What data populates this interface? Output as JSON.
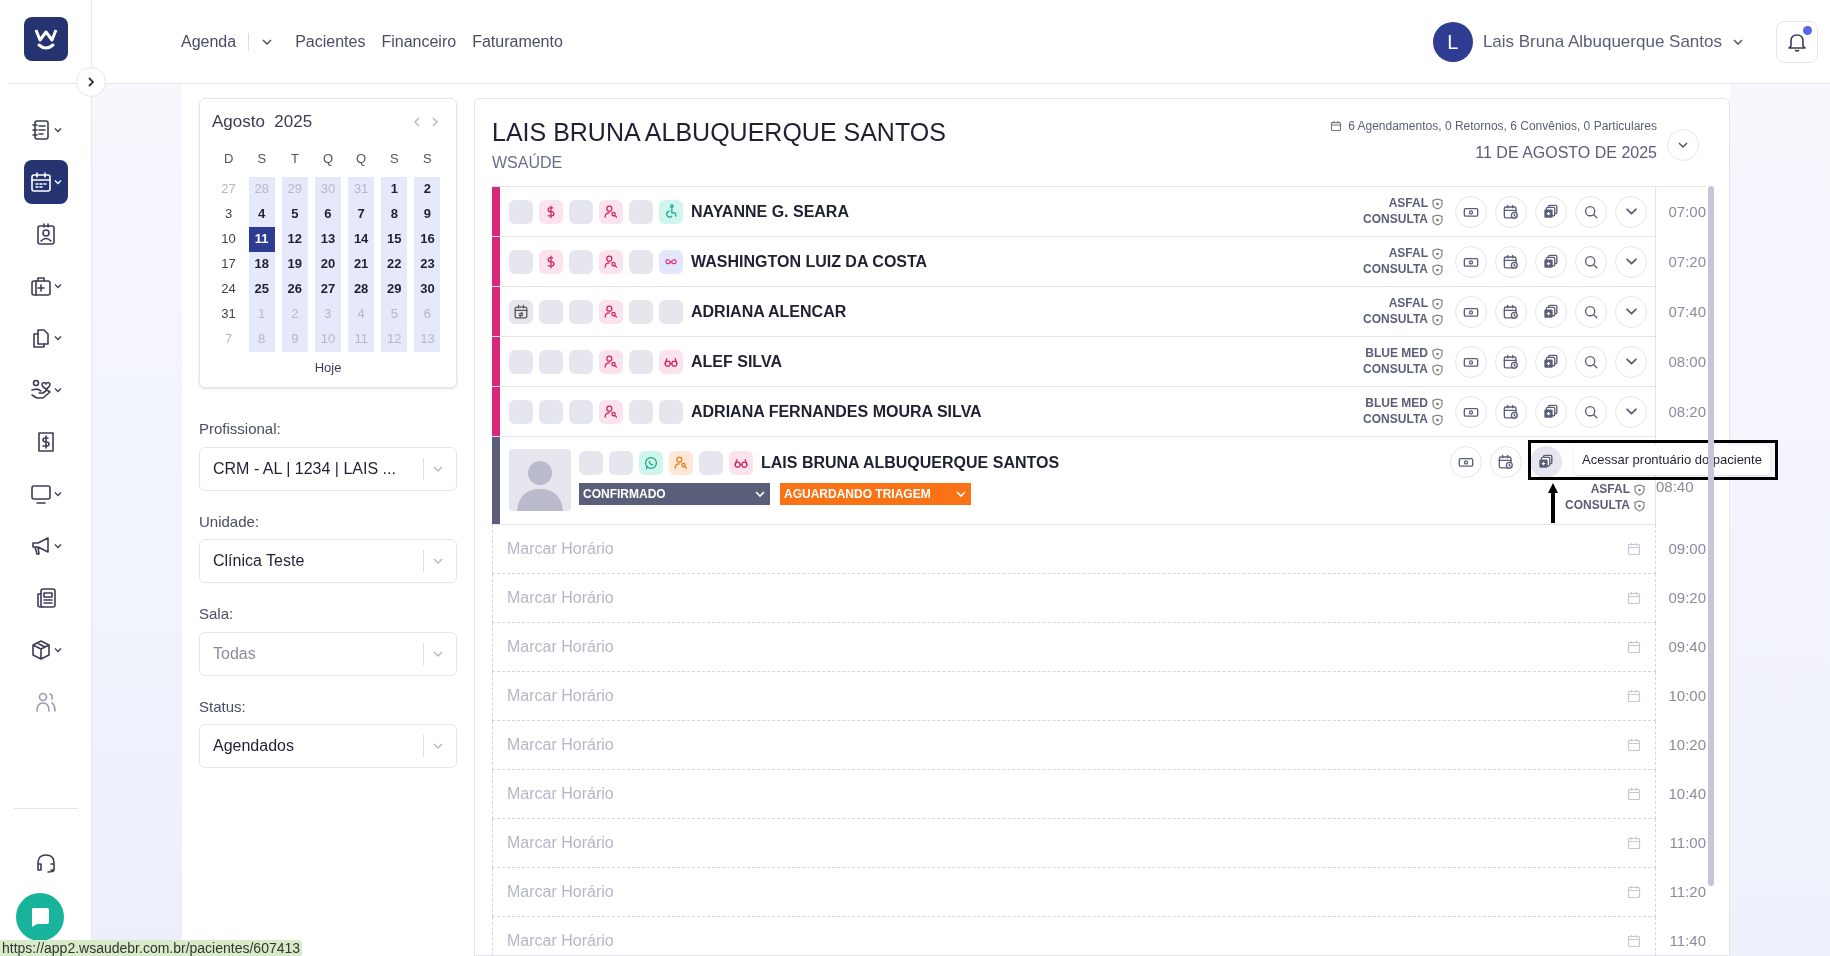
{
  "sidebar": {
    "items": [
      {
        "kind": "notebook",
        "caret": true,
        "selected": false
      },
      {
        "kind": "calendar",
        "caret": true,
        "selected": true
      },
      {
        "kind": "badge",
        "caret": false,
        "selected": false
      },
      {
        "kind": "medkit",
        "caret": true,
        "selected": false
      },
      {
        "kind": "copy",
        "caret": true,
        "selected": false
      },
      {
        "kind": "care",
        "caret": true,
        "selected": false
      },
      {
        "kind": "money",
        "caret": false,
        "selected": false
      },
      {
        "kind": "monitor",
        "caret": true,
        "selected": false
      },
      {
        "kind": "megaphone",
        "caret": true,
        "selected": false
      },
      {
        "kind": "news",
        "caret": false,
        "selected": false
      },
      {
        "kind": "box",
        "caret": true,
        "selected": false
      },
      {
        "kind": "users",
        "caret": false,
        "selected": false
      }
    ],
    "bottom": [
      {
        "kind": "headset"
      }
    ]
  },
  "nav": {
    "items": [
      {
        "label": "Agenda",
        "caret": true
      },
      {
        "label": "Pacientes",
        "caret": false
      },
      {
        "label": "Financeiro",
        "caret": false
      },
      {
        "label": "Faturamento",
        "caret": false
      }
    ]
  },
  "user": {
    "initial": "L",
    "name": "Lais Bruna Albuquerque Santos",
    "notification_dot": true
  },
  "calendar": {
    "month": "Agosto",
    "year": "2025",
    "weekdays": [
      "D",
      "S",
      "T",
      "Q",
      "Q",
      "S",
      "S"
    ],
    "weeks": [
      [
        {
          "label": "27",
          "muted": true,
          "selected": false
        },
        {
          "label": "28",
          "muted": true,
          "selected": false
        },
        {
          "label": "29",
          "muted": true,
          "selected": false
        },
        {
          "label": "30",
          "muted": true,
          "selected": false
        },
        {
          "label": "31",
          "muted": true,
          "selected": false
        },
        {
          "label": "1",
          "muted": false,
          "selected": false
        },
        {
          "label": "2",
          "muted": false,
          "selected": false
        }
      ],
      [
        {
          "label": "3",
          "muted": false,
          "selected": false
        },
        {
          "label": "4",
          "muted": false,
          "selected": false
        },
        {
          "label": "5",
          "muted": false,
          "selected": false
        },
        {
          "label": "6",
          "muted": false,
          "selected": false
        },
        {
          "label": "7",
          "muted": false,
          "selected": false
        },
        {
          "label": "8",
          "muted": false,
          "selected": false
        },
        {
          "label": "9",
          "muted": false,
          "selected": false
        }
      ],
      [
        {
          "label": "10",
          "muted": false,
          "selected": false
        },
        {
          "label": "11",
          "muted": false,
          "selected": true
        },
        {
          "label": "12",
          "muted": false,
          "selected": false
        },
        {
          "label": "13",
          "muted": false,
          "selected": false
        },
        {
          "label": "14",
          "muted": false,
          "selected": false
        },
        {
          "label": "15",
          "muted": false,
          "selected": false
        },
        {
          "label": "16",
          "muted": false,
          "selected": false
        }
      ],
      [
        {
          "label": "17",
          "muted": false,
          "selected": false
        },
        {
          "label": "18",
          "muted": false,
          "selected": false
        },
        {
          "label": "19",
          "muted": false,
          "selected": false
        },
        {
          "label": "20",
          "muted": false,
          "selected": false
        },
        {
          "label": "21",
          "muted": false,
          "selected": false
        },
        {
          "label": "22",
          "muted": false,
          "selected": false
        },
        {
          "label": "23",
          "muted": false,
          "selected": false
        }
      ],
      [
        {
          "label": "24",
          "muted": false,
          "selected": false
        },
        {
          "label": "25",
          "muted": false,
          "selected": false
        },
        {
          "label": "26",
          "muted": false,
          "selected": false
        },
        {
          "label": "27",
          "muted": false,
          "selected": false
        },
        {
          "label": "28",
          "muted": false,
          "selected": false
        },
        {
          "label": "29",
          "muted": false,
          "selected": false
        },
        {
          "label": "30",
          "muted": false,
          "selected": false
        }
      ],
      [
        {
          "label": "31",
          "muted": false,
          "selected": false
        },
        {
          "label": "1",
          "muted": true,
          "selected": false
        },
        {
          "label": "2",
          "muted": true,
          "selected": false
        },
        {
          "label": "3",
          "muted": true,
          "selected": false
        },
        {
          "label": "4",
          "muted": true,
          "selected": false
        },
        {
          "label": "5",
          "muted": true,
          "selected": false
        },
        {
          "label": "6",
          "muted": true,
          "selected": false
        }
      ],
      [
        {
          "label": "7",
          "muted": true,
          "selected": false
        },
        {
          "label": "8",
          "muted": true,
          "selected": false
        },
        {
          "label": "9",
          "muted": true,
          "selected": false
        },
        {
          "label": "10",
          "muted": true,
          "selected": false
        },
        {
          "label": "11",
          "muted": true,
          "selected": false
        },
        {
          "label": "12",
          "muted": true,
          "selected": false
        },
        {
          "label": "13",
          "muted": true,
          "selected": false
        }
      ]
    ],
    "today_button": "Hoje"
  },
  "filters": [
    {
      "label": "Profissional:",
      "value": "CRM - AL | 1234 | LAIS ..."
    },
    {
      "label": "Unidade:",
      "value": "Clínica Teste"
    },
    {
      "label": "Sala:",
      "placeholder": "Todas"
    },
    {
      "label": "Status:",
      "value": "Agendados"
    }
  ],
  "schedule": {
    "title": "LAIS BRUNA ALBUQUERQUE SANTOS",
    "subtitle": "WSAÚDE",
    "summary": "6 Agendamentos, 0 Retornos, 6 Convênios, 0 Particulares",
    "date": "11 DE AGOSTO DE 2025",
    "appointments": [
      {
        "kind": "compact",
        "color": "#d9287a",
        "flags": [
          {
            "kind": "empty"
          },
          {
            "kind": "dollar"
          },
          {
            "kind": "empty"
          },
          {
            "kind": "person-search"
          },
          {
            "kind": "empty"
          },
          {
            "kind": "wheelchair"
          }
        ],
        "name": "NAYANNE G. SEARA",
        "insurance": "ASFAL",
        "procedure": "CONSULTA",
        "time": "07:00"
      },
      {
        "kind": "compact",
        "color": "#d9287a",
        "flags": [
          {
            "kind": "empty"
          },
          {
            "kind": "dollar"
          },
          {
            "kind": "empty"
          },
          {
            "kind": "person-search"
          },
          {
            "kind": "empty"
          },
          {
            "kind": "infinity"
          }
        ],
        "name": "WASHINGTON LUIZ DA COSTA",
        "insurance": "ASFAL",
        "procedure": "CONSULTA",
        "time": "07:20"
      },
      {
        "kind": "compact",
        "color": "#d9287a",
        "flags": [
          {
            "kind": "calendar-sync"
          },
          {
            "kind": "empty"
          },
          {
            "kind": "empty"
          },
          {
            "kind": "person-search"
          },
          {
            "kind": "empty"
          },
          {
            "kind": "empty"
          }
        ],
        "name": "ADRIANA ALENCAR",
        "insurance": "ASFAL",
        "procedure": "CONSULTA",
        "time": "07:40"
      },
      {
        "kind": "compact",
        "color": "#d9287a",
        "flags": [
          {
            "kind": "empty"
          },
          {
            "kind": "empty"
          },
          {
            "kind": "empty"
          },
          {
            "kind": "person-search"
          },
          {
            "kind": "empty"
          },
          {
            "kind": "glasses"
          }
        ],
        "name": "ALEF SILVA",
        "insurance": "BLUE MED",
        "procedure": "CONSULTA",
        "time": "08:00"
      },
      {
        "kind": "compact",
        "color": "#d9287a",
        "flags": [
          {
            "kind": "empty"
          },
          {
            "kind": "empty"
          },
          {
            "kind": "empty"
          },
          {
            "kind": "person-search"
          },
          {
            "kind": "empty"
          },
          {
            "kind": "empty"
          }
        ],
        "name": "ADRIANA FERNANDES MOURA SILVA",
        "insurance": "BLUE MED",
        "procedure": "CONSULTA",
        "time": "08:20"
      },
      {
        "kind": "expanded",
        "color": "#5b5e78",
        "flags": [
          {
            "kind": "empty"
          },
          {
            "kind": "empty"
          },
          {
            "kind": "whatsapp"
          },
          {
            "kind": "person-search-orange"
          },
          {
            "kind": "empty"
          },
          {
            "kind": "glasses"
          }
        ],
        "name": "LAIS BRUNA ALBUQUERQUE SANTOS",
        "insurance": "ASFAL",
        "procedure": "CONSULTA",
        "time": "08:40",
        "statuses": [
          {
            "label": "CONFIRMADO",
            "color": "#5b5e78"
          },
          {
            "label": "AGUARDANDO TRIAGEM",
            "color": "#f97316"
          }
        ],
        "tooltip": "Acessar prontuário do paciente"
      }
    ],
    "free_slots": [
      {
        "placeholder": "Marcar Horário",
        "time": "09:00"
      },
      {
        "placeholder": "Marcar Horário",
        "time": "09:20"
      },
      {
        "placeholder": "Marcar Horário",
        "time": "09:40"
      },
      {
        "placeholder": "Marcar Horário",
        "time": "10:00"
      },
      {
        "placeholder": "Marcar Horário",
        "time": "10:20"
      },
      {
        "placeholder": "Marcar Horário",
        "time": "10:40"
      },
      {
        "placeholder": "Marcar Horário",
        "time": "11:00"
      },
      {
        "placeholder": "Marcar Horário",
        "time": "11:20"
      },
      {
        "placeholder": "Marcar Horário",
        "time": "11:40"
      }
    ]
  },
  "status_url": "https://app2.wsaudebr.com.br/pacientes/607413"
}
